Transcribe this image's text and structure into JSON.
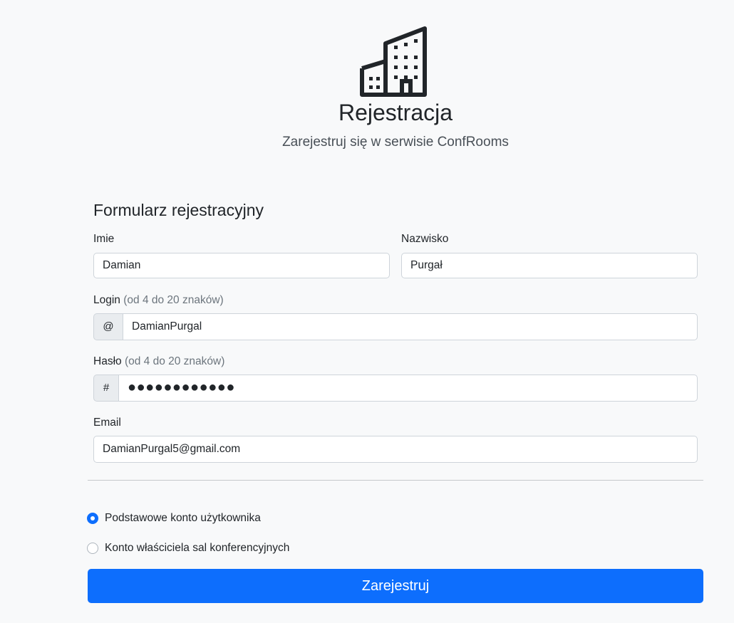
{
  "header": {
    "logo_icon": "building-icon",
    "title": "Rejestracja",
    "subtitle": "Zarejestruj się w serwisie ConfRooms"
  },
  "form": {
    "heading": "Formularz rejestracyjny",
    "first_name": {
      "label": "Imie",
      "value": "Damian"
    },
    "last_name": {
      "label": "Nazwisko",
      "value": "Purgał"
    },
    "login": {
      "label": "Login",
      "hint": "(od 4 do 20 znaków)",
      "prefix": "@",
      "value": "DamianPurgal"
    },
    "password": {
      "label": "Hasło",
      "hint": "(od 4 do 20 znaków)",
      "prefix": "#",
      "masked_value": "●●●●●●●●●●●●"
    },
    "email": {
      "label": "Email",
      "value": "DamianPurgal5@gmail.com"
    },
    "account_type": {
      "options": [
        {
          "label": "Podstawowe konto użytkownika",
          "checked": true
        },
        {
          "label": "Konto właściciela sal konferencyjnych",
          "checked": false
        }
      ]
    },
    "submit_label": "Zarejestruj"
  },
  "colors": {
    "background": "#f8f9fa",
    "primary": "#0d6efd",
    "addon_bg": "#e9ecef",
    "border": "#ced4da",
    "text": "#212529",
    "muted": "#6c757d"
  }
}
